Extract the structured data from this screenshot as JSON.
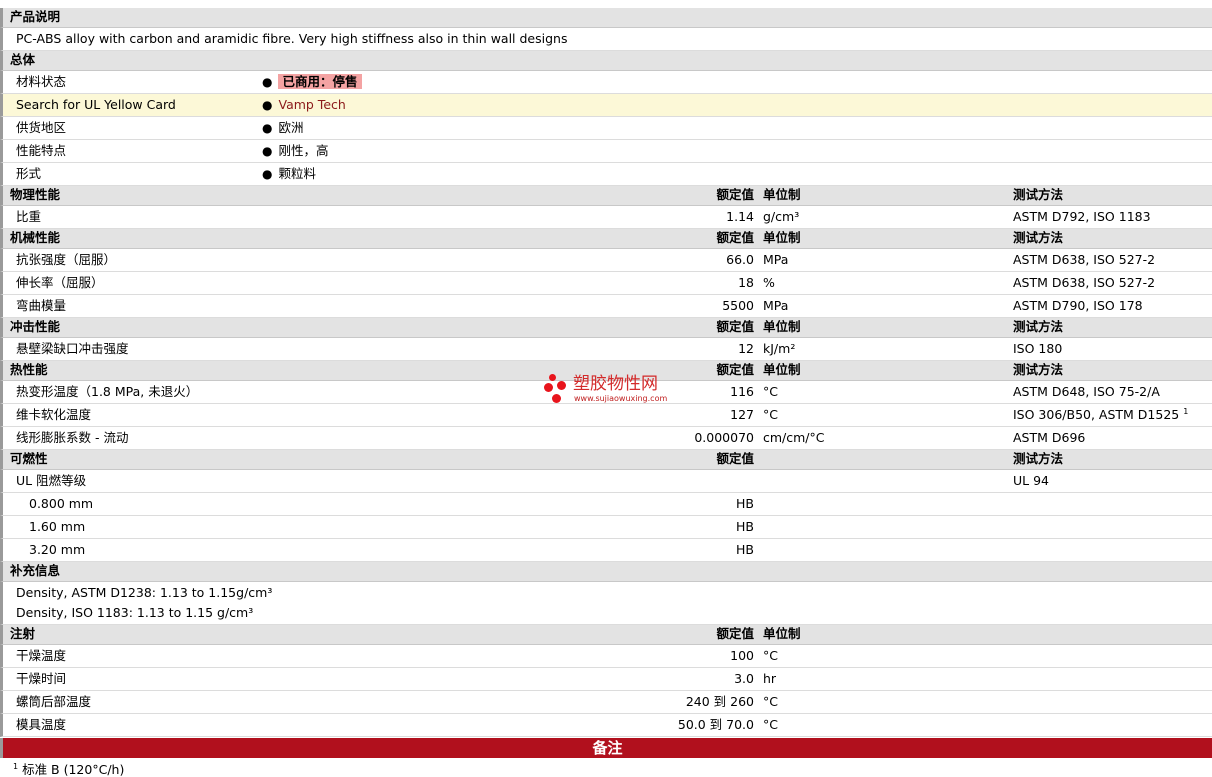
{
  "product_section": {
    "title": "产品说明",
    "description": "PC-ABS alloy with carbon and aramidic fibre. Very high stiffness also in thin wall designs"
  },
  "general": {
    "title": "总体",
    "items": [
      {
        "label": "材料状态",
        "value": "已商用：停售",
        "style": "badge"
      },
      {
        "label": "Search for UL Yellow Card",
        "value": "Vamp Tech",
        "style": "link"
      },
      {
        "label": "供货地区",
        "value": "欧洲"
      },
      {
        "label": "性能特点",
        "value": "刚性，高"
      },
      {
        "label": "形式",
        "value": "颗粒料"
      }
    ]
  },
  "column_headers": {
    "value": "额定值",
    "unit": "单位制",
    "test": "测试方法"
  },
  "physical": {
    "title": "物理性能",
    "rows": [
      {
        "label": "比重",
        "value": "1.14",
        "unit": "g/cm³",
        "test": "ASTM D792, ISO 1183"
      }
    ]
  },
  "mechanical": {
    "title": "机械性能",
    "rows": [
      {
        "label": "抗张强度（屈服）",
        "value": "66.0",
        "unit": "MPa",
        "test": "ASTM D638, ISO 527-2"
      },
      {
        "label": "伸长率（屈服）",
        "value": "18",
        "unit": "%",
        "test": "ASTM D638, ISO 527-2"
      },
      {
        "label": "弯曲模量",
        "value": "5500",
        "unit": "MPa",
        "test": "ASTM D790, ISO 178"
      }
    ]
  },
  "impact": {
    "title": "冲击性能",
    "rows": [
      {
        "label": "悬壁梁缺口冲击强度",
        "value": "12",
        "unit": "kJ/m²",
        "test": "ISO 180"
      }
    ]
  },
  "thermal": {
    "title": "热性能",
    "rows": [
      {
        "label": "热变形温度（1.8 MPa, 未退火）",
        "value": "116",
        "unit": "°C",
        "test": "ASTM D648, ISO 75-2/A"
      },
      {
        "label": "维卡软化温度",
        "value": "127",
        "unit": "°C",
        "test": "ISO 306/B50, ASTM D1525",
        "footnote": "1"
      },
      {
        "label": "线形膨胀系数 - 流动",
        "value": "0.000070",
        "unit": "cm/cm/°C",
        "test": "ASTM D696"
      }
    ]
  },
  "flammability": {
    "title": "可燃性",
    "rating_label": "UL 阻燃等级",
    "rating_test": "UL 94",
    "rows": [
      {
        "label": "0.800 mm",
        "value": "HB"
      },
      {
        "label": "1.60 mm",
        "value": "HB"
      },
      {
        "label": "3.20 mm",
        "value": "HB"
      }
    ]
  },
  "supplemental": {
    "title": "补充信息",
    "lines": [
      "Density, ASTM D1238: 1.13 to 1.15g/cm³",
      "Density, ISO 1183: 1.13 to 1.15 g/cm³"
    ]
  },
  "injection": {
    "title": "注射",
    "rows": [
      {
        "label": "干燥温度",
        "value": "100",
        "unit": "°C"
      },
      {
        "label": "干燥时间",
        "value": "3.0",
        "unit": "hr"
      },
      {
        "label": "螺筒后部温度",
        "value": "240 到  260",
        "unit": "°C"
      },
      {
        "label": "模具温度",
        "value": "50.0 到  70.0",
        "unit": "°C"
      }
    ]
  },
  "notes": {
    "title": "备注",
    "footnote_number": "1",
    "footnote_text": "标准 B (120°C/h)"
  },
  "watermark": {
    "name": "塑胶物性网",
    "url": "www.sujiaowuxing.com",
    "color": "#e8141c"
  }
}
